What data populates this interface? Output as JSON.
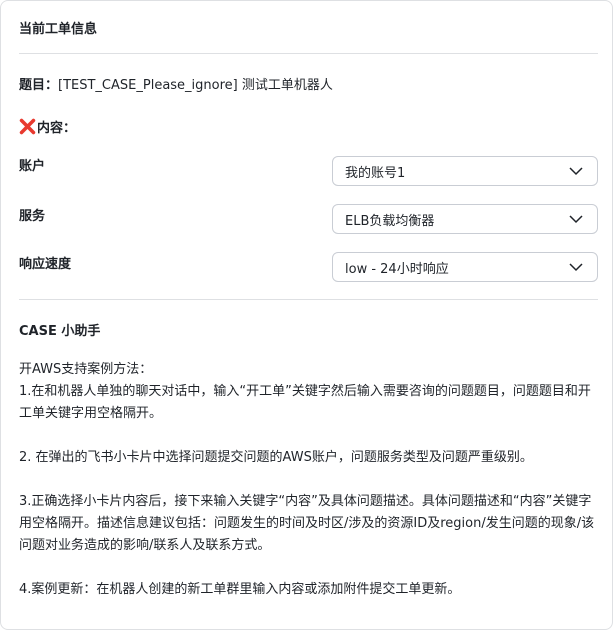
{
  "header": {
    "title": "当前工单信息"
  },
  "subject": {
    "label": "题目：",
    "value": "[TEST_CASE_Please_ignore] 测试工单机器人"
  },
  "content": {
    "icon": "cross-mark-icon",
    "icon_color": "#e8392f",
    "label": "内容："
  },
  "fields": [
    {
      "label": "账户",
      "value": "我的账号1"
    },
    {
      "label": "服务",
      "value": "ELB负载均衡器"
    },
    {
      "label": "响应速度",
      "value": "low - 24小时响应"
    }
  ],
  "helper": {
    "title": "CASE 小助手",
    "intro": "开AWS支持案例方法：",
    "step1": "1.在和机器人单独的聊天对话中，输入“开工单”关键字然后输入需要咨询的问题题目，问题题目和开工单关键字用空格隔开。",
    "step2": "2. 在弹出的飞书小卡片中选择问题提交问题的AWS账户，问题服务类型及问题严重级别。",
    "step3": "3.正确选择小卡片内容后，接下来输入关键字“内容”及具体问题描述。具体问题描述和“内容”关键字用空格隔开。描述信息建议包括：问题发生的时间及时区/涉及的资源ID及region/发生问题的现象/该问题对业务造成的影响/联系人及联系方式。",
    "step4": "4.案例更新：在机器人创建的新工单群里输入内容或添加附件提交工单更新。"
  }
}
